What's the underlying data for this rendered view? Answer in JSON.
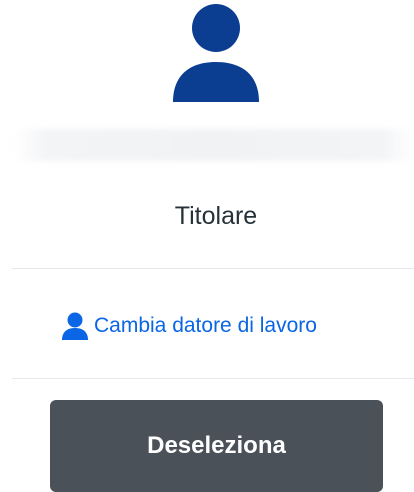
{
  "profile": {
    "avatar_icon": "user-icon",
    "avatar_color": "#0b3d91",
    "role": "Titolare"
  },
  "actions": {
    "change_employer_label": "Cambia datore di lavoro",
    "change_employer_icon": "user-icon",
    "link_color": "#0a66e4",
    "deselect_label": "Deseleziona",
    "deselect_color": "#4b5159"
  }
}
